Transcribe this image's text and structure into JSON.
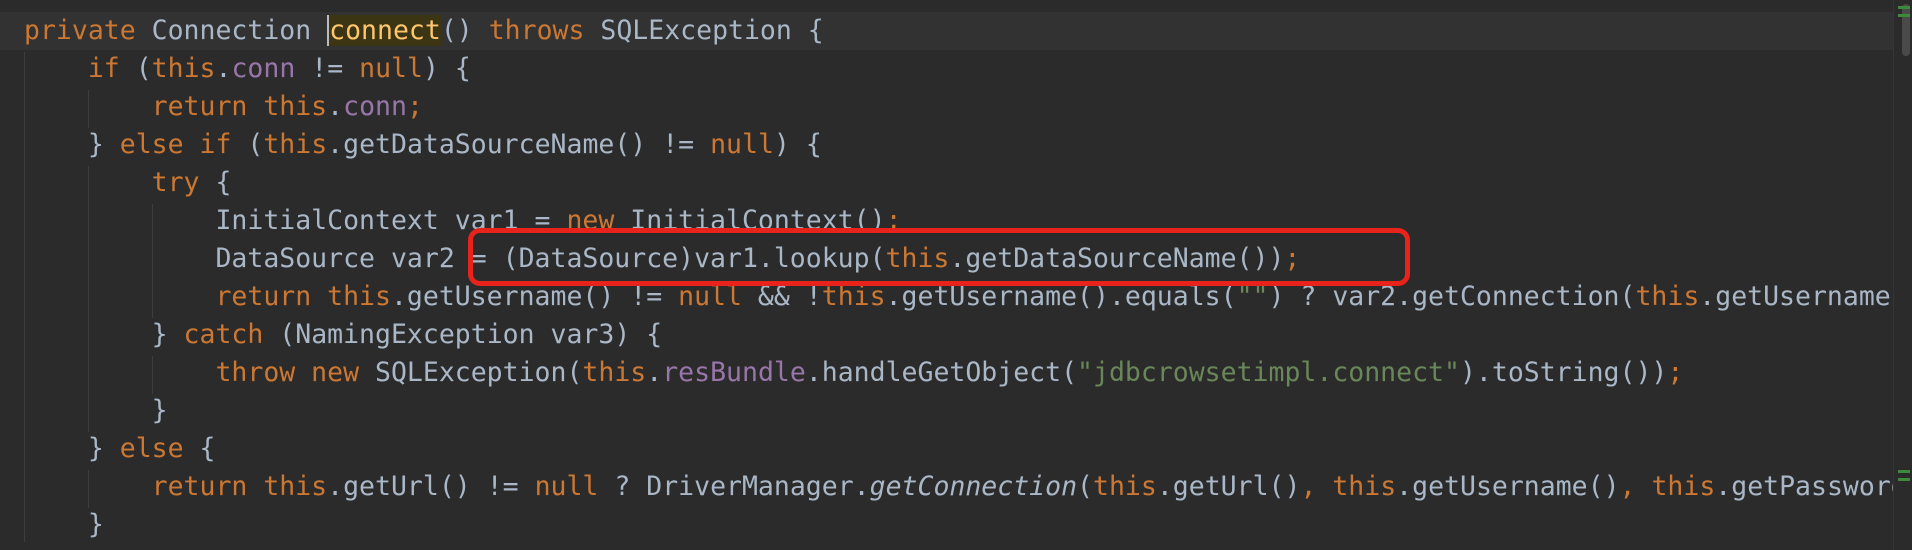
{
  "editor": {
    "language": "java",
    "theme": "Darcula",
    "lines": [
      {
        "tokens": [
          [
            "kw",
            "private "
          ],
          [
            "plain",
            "Connection "
          ],
          [
            "caret",
            "connect"
          ],
          [
            "plain",
            "() "
          ],
          [
            "kw",
            "throws "
          ],
          [
            "plain",
            "SQLException {"
          ]
        ]
      },
      {
        "tokens": [
          [
            "plain",
            "    "
          ],
          [
            "kw",
            "if "
          ],
          [
            "plain",
            "("
          ],
          [
            "kw",
            "this"
          ],
          [
            "plain",
            "."
          ],
          [
            "field",
            "conn"
          ],
          [
            "plain",
            " != "
          ],
          [
            "kw",
            "null"
          ],
          [
            "plain",
            ") {"
          ]
        ]
      },
      {
        "tokens": [
          [
            "plain",
            "        "
          ],
          [
            "kw",
            "return this"
          ],
          [
            "plain",
            "."
          ],
          [
            "field",
            "conn"
          ],
          [
            "kw",
            ";"
          ]
        ]
      },
      {
        "tokens": [
          [
            "plain",
            "    } "
          ],
          [
            "kw",
            "else if "
          ],
          [
            "plain",
            "("
          ],
          [
            "kw",
            "this"
          ],
          [
            "plain",
            ".getDataSourceName() != "
          ],
          [
            "kw",
            "null"
          ],
          [
            "plain",
            ") {"
          ]
        ]
      },
      {
        "tokens": [
          [
            "plain",
            "        "
          ],
          [
            "kw",
            "try "
          ],
          [
            "plain",
            "{"
          ]
        ]
      },
      {
        "tokens": [
          [
            "plain",
            "            InitialContext var1 = "
          ],
          [
            "kw",
            "new "
          ],
          [
            "plain",
            "InitialContext()"
          ],
          [
            "kw",
            ";"
          ]
        ]
      },
      {
        "tokens": [
          [
            "plain",
            "            DataSource var2 = (DataSource)var1.lookup("
          ],
          [
            "kw",
            "this"
          ],
          [
            "plain",
            ".getDataSourceName())"
          ],
          [
            "kw",
            ";"
          ]
        ]
      },
      {
        "tokens": [
          [
            "plain",
            "            "
          ],
          [
            "kw",
            "return this"
          ],
          [
            "plain",
            ".getUsername() != "
          ],
          [
            "kw",
            "null "
          ],
          [
            "plain",
            "&& !"
          ],
          [
            "kw",
            "this"
          ],
          [
            "plain",
            ".getUsername().equals("
          ],
          [
            "str",
            "\"\""
          ],
          [
            "plain",
            ") ? var2.getConnection("
          ],
          [
            "kw",
            "this"
          ],
          [
            "plain",
            ".getUsername("
          ]
        ]
      },
      {
        "tokens": [
          [
            "plain",
            "        } "
          ],
          [
            "kw",
            "catch "
          ],
          [
            "plain",
            "(NamingException var3) {"
          ]
        ]
      },
      {
        "tokens": [
          [
            "plain",
            "            "
          ],
          [
            "kw",
            "throw new "
          ],
          [
            "plain",
            "SQLException("
          ],
          [
            "kw",
            "this"
          ],
          [
            "plain",
            "."
          ],
          [
            "field",
            "resBundle"
          ],
          [
            "plain",
            ".handleGetObject("
          ],
          [
            "str",
            "\"jdbcrowsetimpl.connect\""
          ],
          [
            "plain",
            ").toString())"
          ],
          [
            "kw",
            ";"
          ]
        ]
      },
      {
        "tokens": [
          [
            "plain",
            "        }"
          ]
        ]
      },
      {
        "tokens": [
          [
            "plain",
            "    } "
          ],
          [
            "kw",
            "else "
          ],
          [
            "plain",
            "{"
          ]
        ]
      },
      {
        "tokens": [
          [
            "plain",
            "        "
          ],
          [
            "kw",
            "return this"
          ],
          [
            "plain",
            ".getUrl() != "
          ],
          [
            "kw",
            "null "
          ],
          [
            "plain",
            "? DriverManager."
          ],
          [
            "italic",
            "getConnection"
          ],
          [
            "plain",
            "("
          ],
          [
            "kw",
            "this"
          ],
          [
            "plain",
            ".getUrl()"
          ],
          [
            "kw",
            ", this"
          ],
          [
            "plain",
            ".getUsername()"
          ],
          [
            "kw",
            ", this"
          ],
          [
            "plain",
            ".getPassword"
          ]
        ]
      },
      {
        "tokens": [
          [
            "plain",
            "    }"
          ]
        ]
      }
    ]
  },
  "annotation": {
    "shape": "rounded-rectangle",
    "color": "#e8231c",
    "target": "DataSource var2 = (DataSource)var1.lookup(this.getDataSourceName());"
  }
}
